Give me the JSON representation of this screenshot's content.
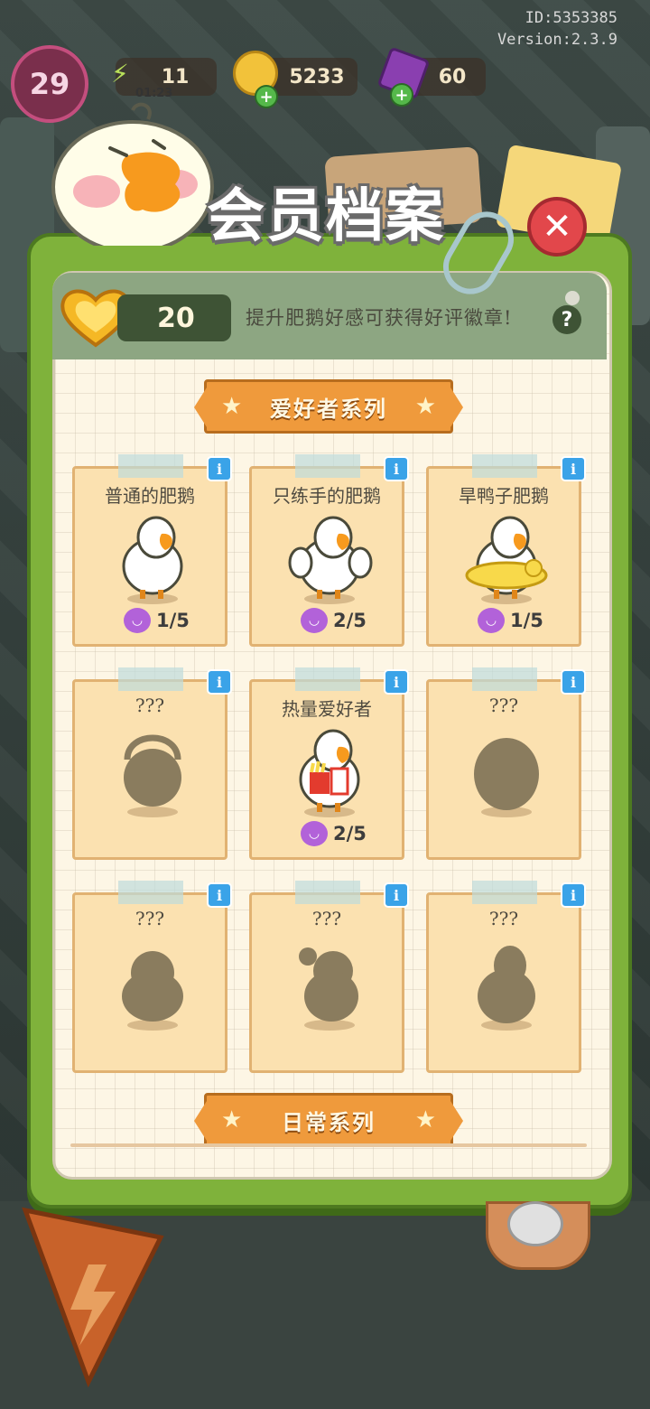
{
  "hud": {
    "user_id": "ID:5353385",
    "version": "Version:2.3.9",
    "level": "29",
    "energy": "11",
    "energy_timer": "01:23",
    "coins": "5233",
    "gems": "60"
  },
  "dialog": {
    "title": "会员档案",
    "favor_count": "20",
    "hint": "提升肥鹅好感可获得好评徽章!",
    "help_label": "?"
  },
  "sections": [
    {
      "title": "爱好者系列",
      "cards": [
        {
          "name": "普通的肥鹅",
          "progress": "1/5",
          "unlocked": true,
          "variant": "plain"
        },
        {
          "name": "只练手的肥鹅",
          "progress": "2/5",
          "unlocked": true,
          "variant": "muscle"
        },
        {
          "name": "旱鸭子肥鹅",
          "progress": "1/5",
          "unlocked": true,
          "variant": "float"
        },
        {
          "name": "???",
          "progress": "",
          "unlocked": false,
          "variant": "headphones"
        },
        {
          "name": "热量爱好者",
          "progress": "2/5",
          "unlocked": true,
          "variant": "fastfood"
        },
        {
          "name": "???",
          "progress": "",
          "unlocked": false,
          "variant": "round"
        },
        {
          "name": "???",
          "progress": "",
          "unlocked": false,
          "variant": "fluffy"
        },
        {
          "name": "???",
          "progress": "",
          "unlocked": false,
          "variant": "ponytail"
        },
        {
          "name": "???",
          "progress": "",
          "unlocked": false,
          "variant": "pear"
        }
      ]
    },
    {
      "title": "日常系列",
      "cards": []
    }
  ],
  "colors": {
    "panel_green": "#7fb23b",
    "ribbon_orange": "#ef9a3c",
    "card_bg": "#fbe1b0",
    "heart_purple": "#b262d9",
    "close_red": "#e2474b",
    "info_blue": "#3aa3e8"
  }
}
